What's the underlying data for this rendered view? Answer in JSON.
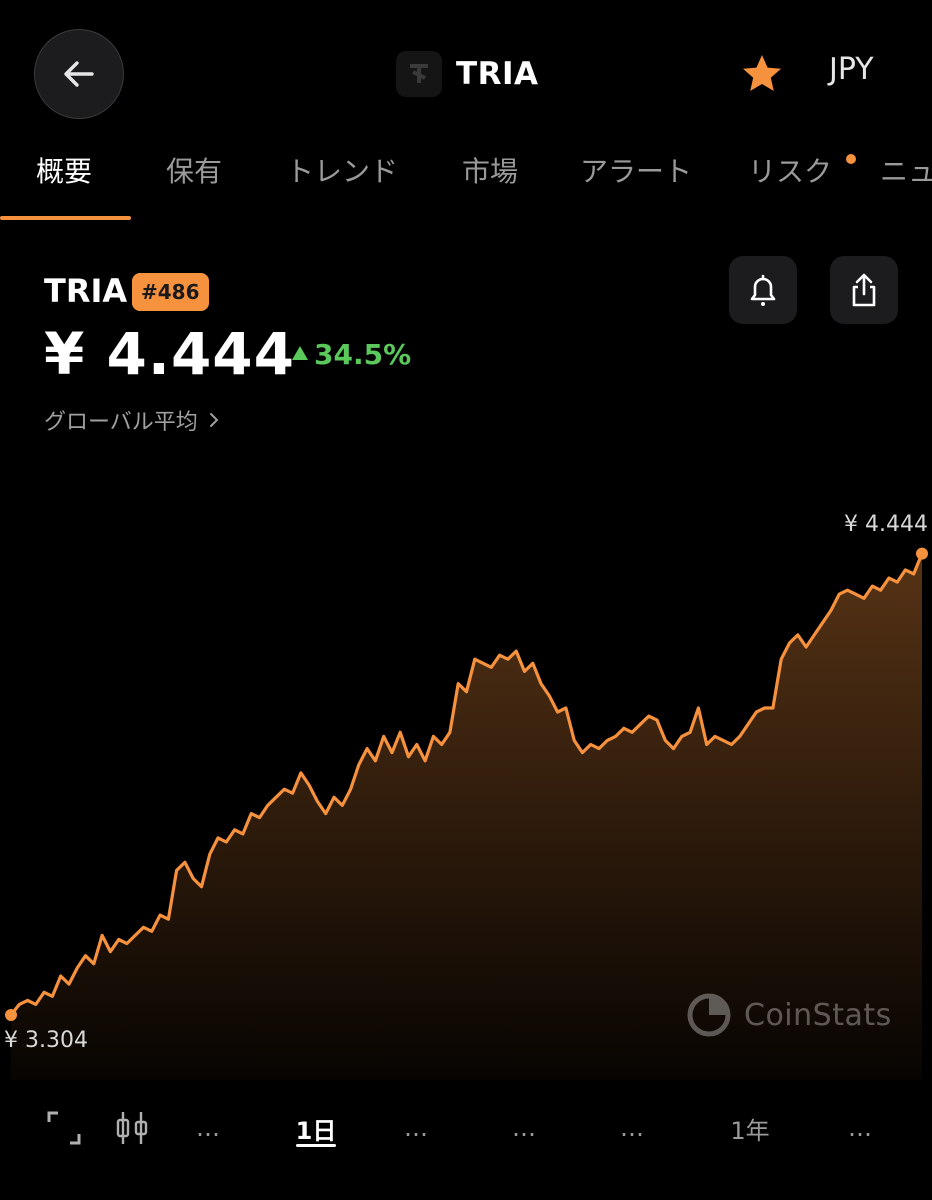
{
  "header": {
    "title": "TRIA",
    "currency": "JPY",
    "back_icon": "arrow-left-icon",
    "favorite_icon": "star-icon",
    "accent_color": "#f6913d"
  },
  "tabs": [
    {
      "label": "概要",
      "active": true
    },
    {
      "label": "保有"
    },
    {
      "label": "トレンド"
    },
    {
      "label": "市場"
    },
    {
      "label": "アラート"
    },
    {
      "label": "リスク",
      "badge_dot": true
    },
    {
      "label": "ニュ"
    }
  ],
  "coin": {
    "symbol": "TRIA",
    "rank": "#486",
    "price": "¥ 4.444",
    "change": "34.5%",
    "change_color": "#5ac85a",
    "price_source": "グローバル平均",
    "actions": [
      "bell-icon",
      "share-icon"
    ]
  },
  "chart_data": {
    "type": "area",
    "line_color": "#f6913d",
    "max_label": "¥ 4.444",
    "min_label": "¥ 3.304",
    "ylim": [
      3.304,
      4.444
    ],
    "values": [
      3.304,
      3.33,
      3.34,
      3.33,
      3.36,
      3.35,
      3.4,
      3.38,
      3.42,
      3.45,
      3.43,
      3.5,
      3.46,
      3.49,
      3.48,
      3.5,
      3.52,
      3.51,
      3.55,
      3.54,
      3.66,
      3.68,
      3.64,
      3.62,
      3.7,
      3.74,
      3.73,
      3.76,
      3.75,
      3.8,
      3.79,
      3.82,
      3.84,
      3.86,
      3.85,
      3.9,
      3.87,
      3.83,
      3.8,
      3.84,
      3.82,
      3.86,
      3.92,
      3.96,
      3.93,
      3.99,
      3.95,
      4.0,
      3.94,
      3.97,
      3.93,
      3.99,
      3.97,
      4.0,
      4.12,
      4.1,
      4.18,
      4.17,
      4.16,
      4.19,
      4.18,
      4.2,
      4.15,
      4.17,
      4.12,
      4.09,
      4.05,
      4.06,
      3.98,
      3.95,
      3.97,
      3.96,
      3.98,
      3.99,
      4.01,
      4.0,
      4.02,
      4.04,
      4.03,
      3.98,
      3.96,
      3.99,
      4.0,
      4.06,
      3.97,
      3.99,
      3.98,
      3.97,
      3.99,
      4.02,
      4.05,
      4.06,
      4.06,
      4.18,
      4.22,
      4.24,
      4.21,
      4.24,
      4.27,
      4.3,
      4.34,
      4.35,
      4.34,
      4.33,
      4.36,
      4.35,
      4.38,
      4.37,
      4.4,
      4.39,
      4.44
    ]
  },
  "watermark": {
    "text": "CoinStats",
    "icon": "coinstats-logo-icon"
  },
  "toolbar": {
    "expand_icon": "fullscreen-icon",
    "candle_icon": "candlestick-icon",
    "dots": "…",
    "period_1d": "1日",
    "period_1y": "1年"
  }
}
